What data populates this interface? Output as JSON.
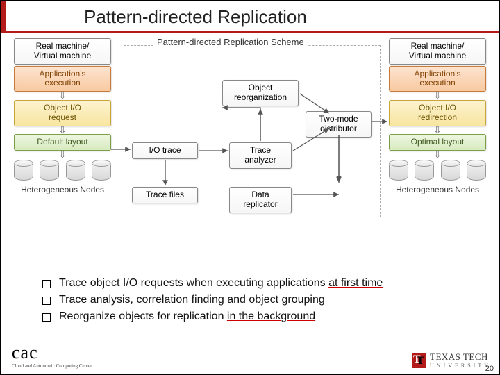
{
  "title": "Pattern-directed Replication",
  "scheme_label": "Pattern-directed Replication Scheme",
  "left": {
    "vm": "Real machine/\nVirtual machine",
    "app": "Application's\nexecution",
    "io": "Object I/O\nrequest",
    "layout": "Default layout",
    "nodes": "Heterogeneous Nodes"
  },
  "right": {
    "vm": "Real machine/\nVirtual machine",
    "app": "Application's\nexecution",
    "io": "Object I/O\nredirection",
    "layout": "Optimal layout",
    "nodes": "Heterogeneous Nodes"
  },
  "mid": {
    "iotrace": "I/O trace",
    "tracefiles": "Trace files",
    "reorg": "Object\nreorganization",
    "analyzer": "Trace\nanalyzer",
    "replicator": "Data\nreplicator",
    "distributor": "Two-mode\ndistributor"
  },
  "bullets": [
    {
      "pre": "Trace object I/O requests when executing applications ",
      "ul": "at first time",
      "post": ""
    },
    {
      "pre": "Trace analysis, correlation finding and object grouping",
      "ul": "",
      "post": ""
    },
    {
      "pre": "Reorganize objects for replication ",
      "ul": "in the background",
      "post": ""
    }
  ],
  "logo_cac_sub": "Cloud and Autonomic Computing Center",
  "ttu": {
    "l1": "TEXAS TECH",
    "l2": "UNIVERSITY"
  },
  "page": "20"
}
